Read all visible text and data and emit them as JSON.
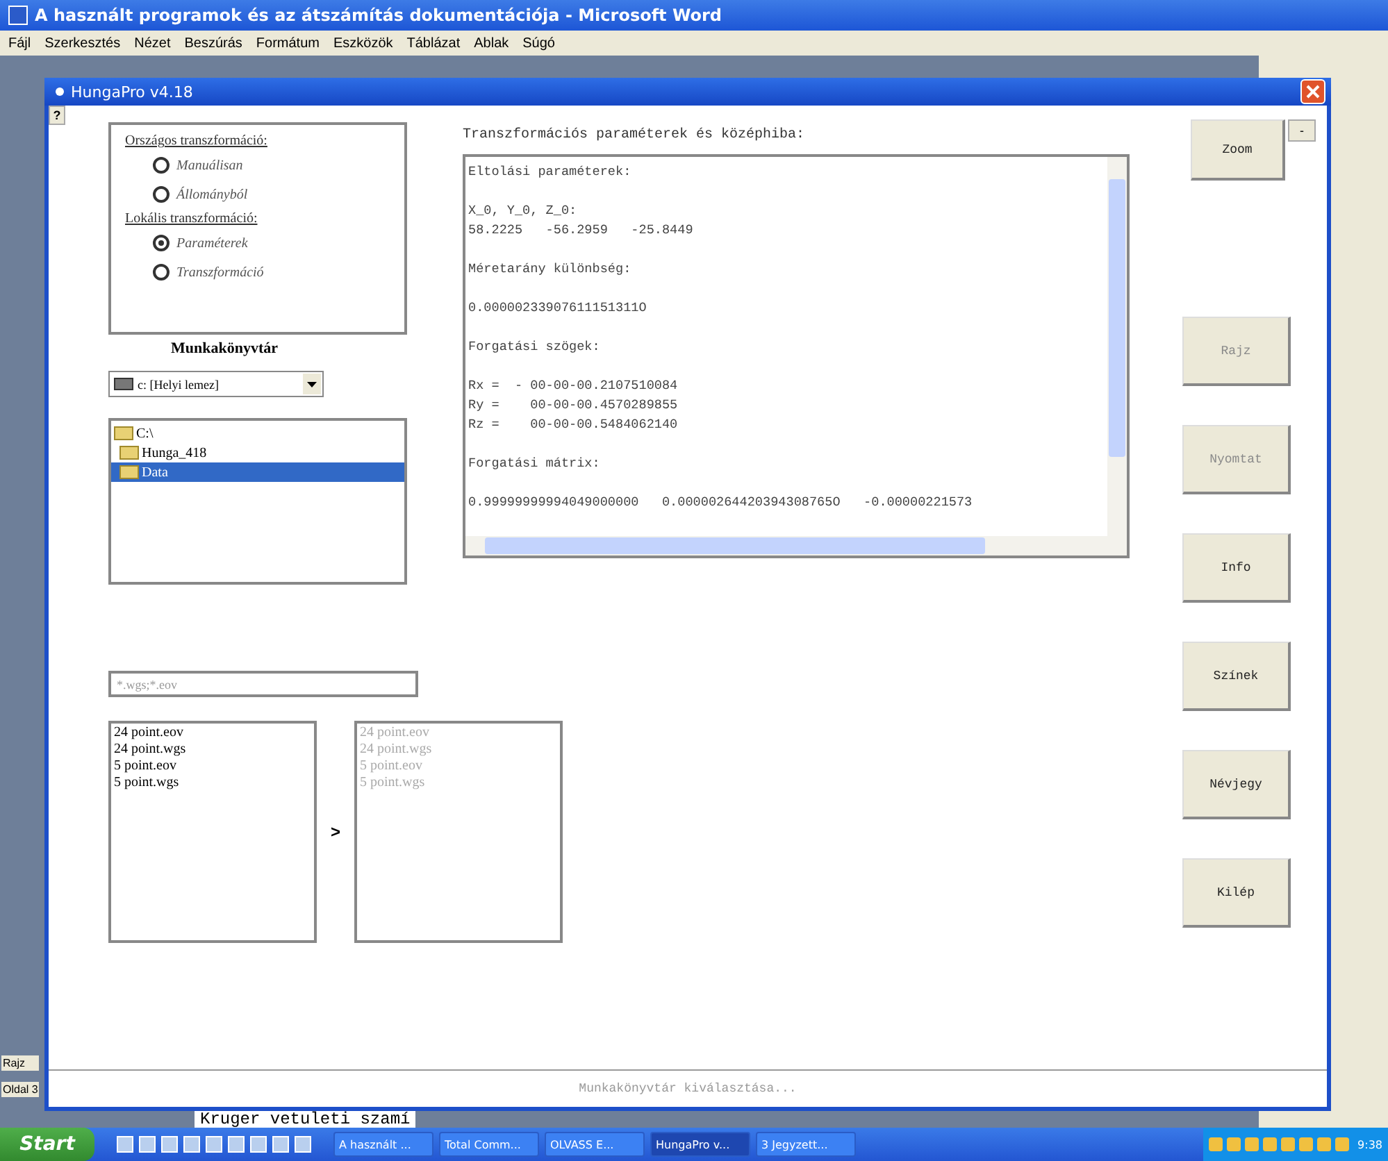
{
  "background_window": {
    "title": "A használt programok és az átszámítás dokumentációja - Microsoft Word",
    "menu": [
      "Fájl",
      "Szerkesztés",
      "Nézet",
      "Beszúrás",
      "Formátum",
      "Eszközök",
      "Táblázat",
      "Ablak",
      "Súgó"
    ],
    "side_labels": [
      "Rajz",
      "Oldal 3"
    ],
    "body_text": "Kruger vetuleti szamí"
  },
  "window": {
    "title": "HungaPro v4.18",
    "help": "?",
    "minimize": "-"
  },
  "transform_group": {
    "sections": [
      {
        "title": "Országos transzformáció:",
        "options": [
          {
            "label": "Manuálisan",
            "selected": false
          },
          {
            "label": "Állományból",
            "selected": false
          }
        ]
      },
      {
        "title": "Lokális transzformáció:",
        "options": [
          {
            "label": "Paraméterek",
            "selected": true
          },
          {
            "label": "Transzformáció",
            "selected": false
          }
        ]
      }
    ]
  },
  "workdir": {
    "title": "Munkakönyvtár",
    "drive": "c: [Helyi lemez]",
    "tree": [
      {
        "label": "C:\\",
        "selected": false
      },
      {
        "label": "Hunga_418",
        "selected": false
      },
      {
        "label": "Data",
        "selected": true
      }
    ]
  },
  "filter": {
    "value": "*.wgs;*.eov"
  },
  "source_files": {
    "disabled": false,
    "items": [
      "24 point.eov",
      "24 point.wgs",
      "5 point.eov",
      "5 point.wgs"
    ]
  },
  "move_button": ">",
  "target_files": {
    "disabled": true,
    "items": [
      "24 point.eov",
      "24 point.wgs",
      "5 point.eov",
      "5 point.wgs"
    ]
  },
  "results": {
    "title": "Transzformációs paraméterek és középhiba:",
    "paragraphs": [
      [
        "Eltolási paraméterek:"
      ],
      [
        "X_0, Y_0, Z_0:",
        "58.2225   -56.2959   -25.8449"
      ],
      [
        "Méretarány különbség:"
      ],
      [
        "0.00000233907611151311O"
      ],
      [
        "Forgatási szögek:"
      ],
      [
        "Rx =  - 00-00-00.2107510084",
        "Ry =    00-00-00.4570289855",
        "Rz =    00-00-00.5484062140"
      ],
      [
        "Forgatási mátrix:"
      ],
      [
        "0.99999999994049000000   0.00000264420394308765O   -0.00000221573"
      ]
    ]
  },
  "buttons": [
    {
      "label": "Zoom",
      "disabled": false
    },
    {
      "label": "Rajz",
      "disabled": true
    },
    {
      "label": "Nyomtat",
      "disabled": true
    },
    {
      "label": "Info",
      "disabled": false
    },
    {
      "label": "Színek",
      "disabled": false
    },
    {
      "label": "Névjegy",
      "disabled": false
    },
    {
      "label": "Kilép",
      "disabled": false
    }
  ],
  "status_bar": "Munkakönyvtár kiválasztása...",
  "taskbar": {
    "start": "Start",
    "tasks": [
      {
        "label": "A használt ...",
        "selected": false
      },
      {
        "label": "Total Comm...",
        "selected": false
      },
      {
        "label": "OLVASS E...",
        "selected": false
      },
      {
        "label": "HungaPro v...",
        "selected": true
      },
      {
        "label": "3 Jegyzett...",
        "selected": false
      }
    ],
    "clock": "9:38"
  }
}
